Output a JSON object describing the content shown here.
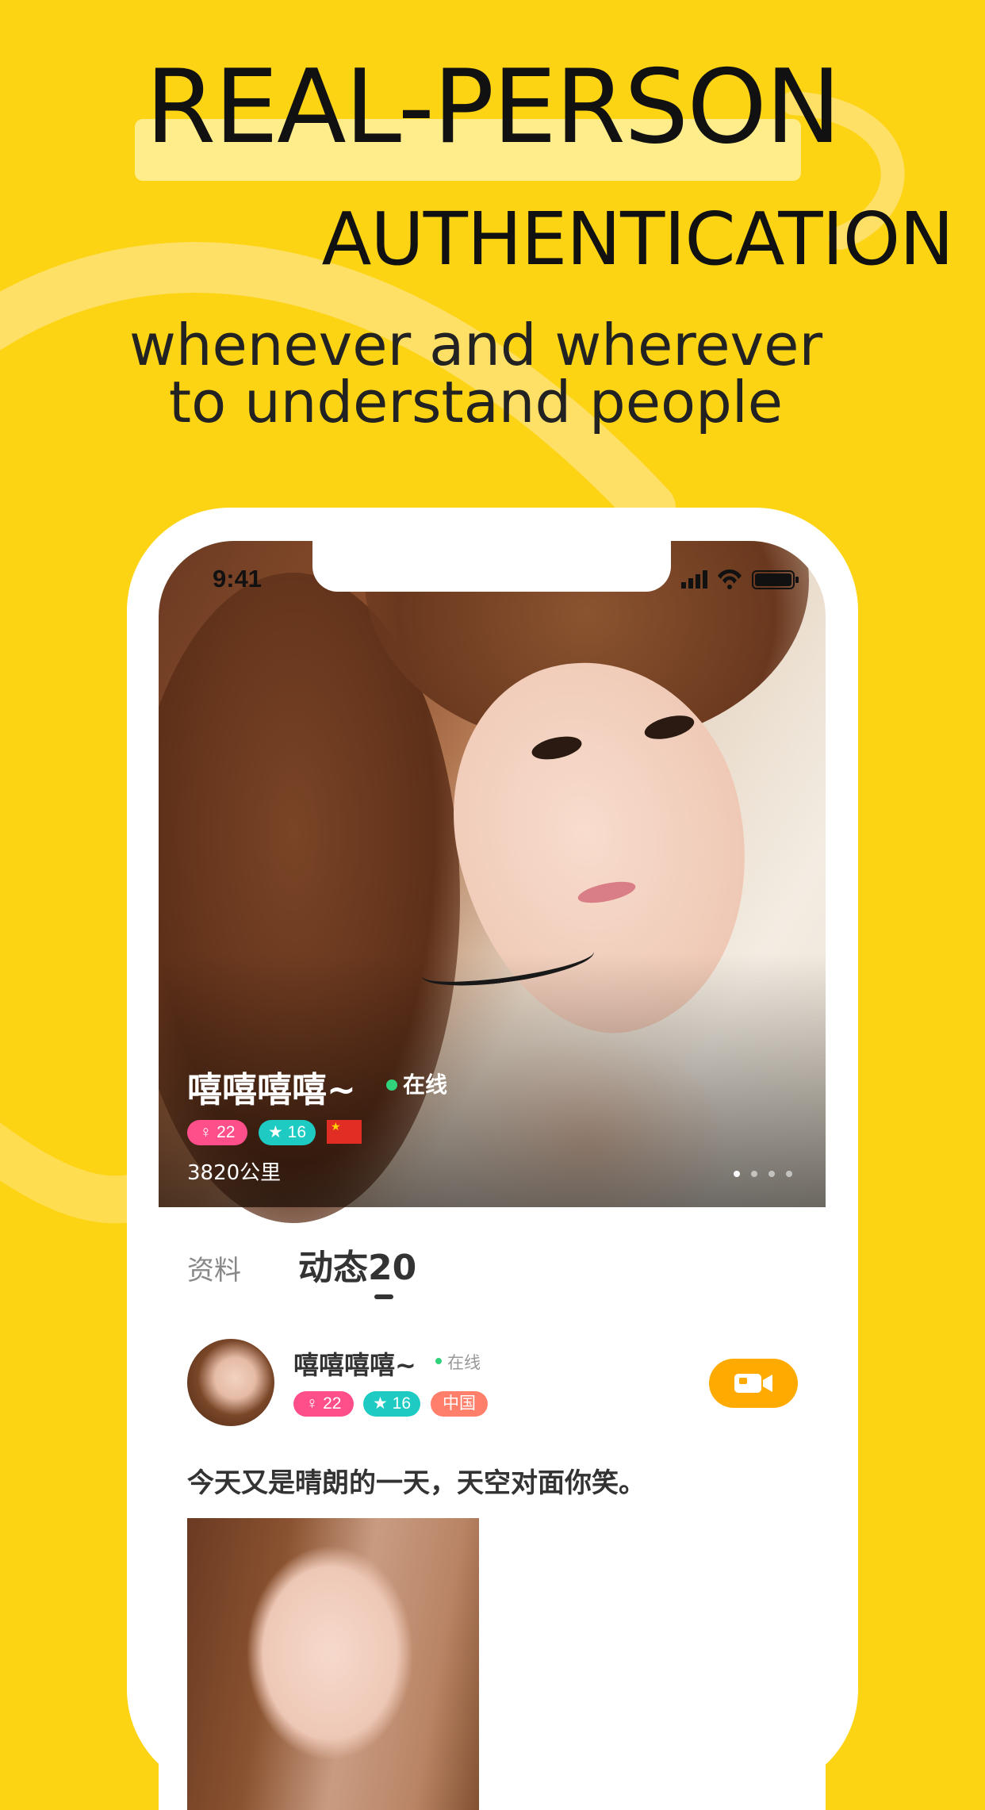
{
  "headline": {
    "line1": "REAL-PERSON",
    "line2": "AUTHENTICATION",
    "subline1": "whenever and wherever",
    "subline2": "to understand people"
  },
  "status_bar": {
    "time": "9:41",
    "icons": [
      "signal-icon",
      "wifi-icon",
      "battery-icon"
    ]
  },
  "profile": {
    "name": "嘻嘻嘻嘻~",
    "online": "在线",
    "tags": {
      "female_age": "22",
      "level": "16"
    },
    "country_flag": "china-flag-icon",
    "distance": "3820公里",
    "photo_count": 4,
    "current_photo": 1
  },
  "tabs": [
    {
      "label": "资料",
      "active": false
    },
    {
      "label": "动态20",
      "active": true
    }
  ],
  "post": {
    "author": "嘻嘻嘻嘻~",
    "online": "在线",
    "tags": {
      "female_age": "22",
      "level": "16",
      "country": "中国"
    },
    "text": "今天又是晴朗的一天，天空对面你笑。",
    "video_call_icon": "video-camera-icon"
  },
  "colors": {
    "background": "#FDD414",
    "highlight": "#FFEC8A",
    "online": "#31D27C",
    "tag_pink": "#FF4F8B",
    "tag_teal": "#1ECBC3",
    "tag_country": "#FF7F6A",
    "video_button": "#FFAA00"
  }
}
